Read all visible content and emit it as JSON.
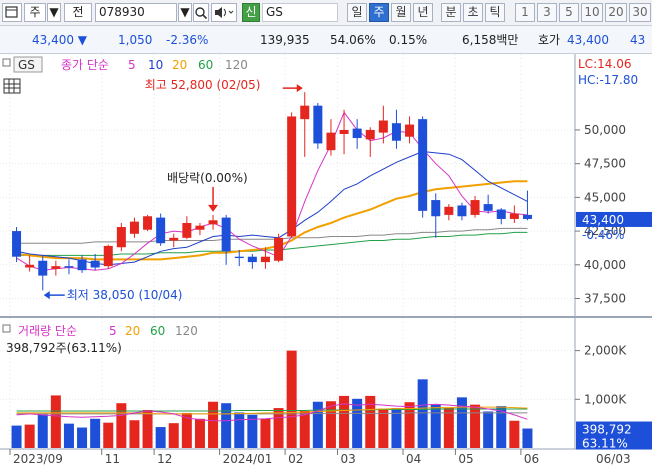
{
  "toolbar": {
    "type_label": "주",
    "prev_label": "전",
    "code": "078930",
    "badge": "신",
    "name": "GS",
    "periods": [
      "일",
      "주",
      "월",
      "년",
      "분",
      "초",
      "틱"
    ],
    "selected_period": "주",
    "numbers": [
      "1",
      "3",
      "5",
      "10",
      "20",
      "30"
    ]
  },
  "info": {
    "price": "43,400 ▼",
    "change": "1,050",
    "change_pct": "-2.36%",
    "volume": "139,935",
    "vol_ratio": "54.06%",
    "turnover": "0.15%",
    "amount": "6,158백만",
    "quote_label": "호가",
    "quote_price": "43,400",
    "quote_count": "43"
  },
  "price_panel": {
    "tag": "GS",
    "legend_prefix": "종가 단순",
    "ma_values": [
      "5",
      "10",
      "20",
      "60",
      "120"
    ],
    "ma_colors": [
      "#d633c8",
      "#1f3fc8",
      "#f2a000",
      "#22a048",
      "#888888"
    ],
    "lc_label": "LC:14.06",
    "hc_label": "HC:-17.80",
    "y_ticks": [
      "50,000",
      "47,500",
      "45,000",
      "42,500",
      "40,000",
      "37,500"
    ],
    "current_price": "43,400",
    "current_pct": "-0.46%",
    "high_label": "최고 52,800 (02/05)",
    "low_label": "최저 38,050 (10/04)",
    "dividend_label": "배당락(0.00%)"
  },
  "volume_panel": {
    "title": "거래량 단순",
    "ma_values": [
      "5",
      "20",
      "60",
      "120"
    ],
    "ma_colors": [
      "#d633c8",
      "#f2a000",
      "#22a048",
      "#888888"
    ],
    "value_label": "398,792주(63.11%)",
    "y_ticks": [
      "2,000K",
      "1,000K"
    ],
    "current_value": "398,792",
    "current_pct": "63.11%"
  },
  "x_axis": [
    "2023/09",
    "11",
    "12",
    "2024/01",
    "02",
    "03",
    "04",
    "05",
    "06",
    "06/03"
  ],
  "colors": {
    "up": "#e5261e",
    "down": "#1d4fd8",
    "ma5": "#d633c8",
    "ma10": "#1f3fc8",
    "ma20": "#f2a000",
    "ma60": "#22a048",
    "ma120": "#888888"
  },
  "chart_data": {
    "type": "candlestick",
    "candles": [
      {
        "o": 42500,
        "h": 42800,
        "l": 40200,
        "c": 40600
      },
      {
        "o": 39800,
        "h": 40700,
        "l": 39500,
        "c": 40000
      },
      {
        "o": 40300,
        "h": 40700,
        "l": 38100,
        "c": 39200
      },
      {
        "o": 39700,
        "h": 40300,
        "l": 39200,
        "c": 39900
      },
      {
        "o": 39900,
        "h": 40400,
        "l": 39300,
        "c": 39800
      },
      {
        "o": 40400,
        "h": 40700,
        "l": 39400,
        "c": 39600
      },
      {
        "o": 40300,
        "h": 40800,
        "l": 39600,
        "c": 39800
      },
      {
        "o": 39900,
        "h": 41500,
        "l": 39700,
        "c": 41400
      },
      {
        "o": 41300,
        "h": 43100,
        "l": 41000,
        "c": 42800
      },
      {
        "o": 42300,
        "h": 43500,
        "l": 42000,
        "c": 43200
      },
      {
        "o": 42600,
        "h": 43700,
        "l": 42500,
        "c": 43600
      },
      {
        "o": 43500,
        "h": 43800,
        "l": 41400,
        "c": 41600
      },
      {
        "o": 41800,
        "h": 42300,
        "l": 41300,
        "c": 42000
      },
      {
        "o": 42000,
        "h": 43600,
        "l": 41900,
        "c": 43100
      },
      {
        "o": 42600,
        "h": 43100,
        "l": 42200,
        "c": 42900
      },
      {
        "o": 43000,
        "h": 43700,
        "l": 42600,
        "c": 43300
      },
      {
        "o": 43500,
        "h": 43700,
        "l": 40000,
        "c": 41000
      },
      {
        "o": 40600,
        "h": 41100,
        "l": 39900,
        "c": 40500
      },
      {
        "o": 40600,
        "h": 40800,
        "l": 39700,
        "c": 40200
      },
      {
        "o": 40200,
        "h": 41300,
        "l": 39700,
        "c": 40600
      },
      {
        "o": 40300,
        "h": 42300,
        "l": 40200,
        "c": 42000
      },
      {
        "o": 42100,
        "h": 51300,
        "l": 42000,
        "c": 51000
      },
      {
        "o": 50800,
        "h": 52800,
        "l": 48000,
        "c": 51800
      },
      {
        "o": 51800,
        "h": 52000,
        "l": 48600,
        "c": 49000
      },
      {
        "o": 48500,
        "h": 50800,
        "l": 48100,
        "c": 49800
      },
      {
        "o": 49700,
        "h": 51500,
        "l": 48200,
        "c": 50000
      },
      {
        "o": 50100,
        "h": 50800,
        "l": 48600,
        "c": 49400
      },
      {
        "o": 49300,
        "h": 50200,
        "l": 48000,
        "c": 50000
      },
      {
        "o": 49800,
        "h": 51800,
        "l": 49000,
        "c": 50700
      },
      {
        "o": 50500,
        "h": 51500,
        "l": 48600,
        "c": 49200
      },
      {
        "o": 49500,
        "h": 51000,
        "l": 49000,
        "c": 50400
      },
      {
        "o": 50800,
        "h": 51000,
        "l": 43500,
        "c": 44000
      },
      {
        "o": 44800,
        "h": 45300,
        "l": 42000,
        "c": 43600
      },
      {
        "o": 43700,
        "h": 44500,
        "l": 43300,
        "c": 44300
      },
      {
        "o": 44400,
        "h": 44600,
        "l": 43300,
        "c": 43600
      },
      {
        "o": 43700,
        "h": 45100,
        "l": 43500,
        "c": 44800
      },
      {
        "o": 44500,
        "h": 45200,
        "l": 43800,
        "c": 44000
      },
      {
        "o": 44100,
        "h": 44200,
        "l": 43000,
        "c": 43400
      },
      {
        "o": 43400,
        "h": 44400,
        "l": 43100,
        "c": 43800
      },
      {
        "o": 43700,
        "h": 45500,
        "l": 43300,
        "c": 43400
      }
    ],
    "volume_k": [
      460,
      480,
      690,
      1080,
      500,
      420,
      600,
      520,
      920,
      570,
      780,
      430,
      510,
      720,
      600,
      950,
      920,
      730,
      680,
      600,
      820,
      2000,
      760,
      950,
      960,
      1070,
      1010,
      1070,
      810,
      820,
      940,
      1410,
      890,
      830,
      1040,
      890,
      750,
      860,
      560,
      400
    ],
    "ma_lines": {
      "ma5": [
        40500,
        39900,
        39600,
        39700,
        39800,
        39700,
        39600,
        39700,
        40100,
        40800,
        41600,
        42300,
        42500,
        42400,
        42800,
        43100,
        42700,
        41900,
        41400,
        41000,
        40600,
        42100,
        44700,
        47000,
        48900,
        51300,
        50000,
        49200,
        49400,
        49900,
        49800,
        48600,
        47500,
        46600,
        45100,
        44000,
        43900,
        44000,
        43800,
        43700
      ],
      "ma10": [
        41000,
        40800,
        40700,
        40600,
        40500,
        40300,
        40100,
        40000,
        40100,
        40200,
        40600,
        41000,
        41200,
        41300,
        41700,
        42100,
        42200,
        42100,
        42200,
        42100,
        42000,
        42600,
        43300,
        43900,
        44700,
        45600,
        46000,
        46600,
        47100,
        47600,
        48000,
        48400,
        48300,
        48200,
        47800,
        47000,
        46200,
        45700,
        45200,
        44700
      ],
      "ma20": [
        40800,
        40700,
        40600,
        40500,
        40500,
        40500,
        40400,
        40400,
        40400,
        40400,
        40400,
        40400,
        40500,
        40600,
        40700,
        40900,
        40900,
        41000,
        41100,
        41200,
        41400,
        41800,
        42400,
        42800,
        43100,
        43500,
        43800,
        44100,
        44500,
        44900,
        45100,
        45400,
        45600,
        45700,
        45800,
        45900,
        46000,
        46100,
        46200,
        46200
      ],
      "ma60": [
        40700,
        40700,
        40700,
        40700,
        40700,
        40700,
        40700,
        40700,
        40800,
        40800,
        40800,
        40900,
        40900,
        40900,
        41000,
        41000,
        41000,
        41000,
        41000,
        41100,
        41100,
        41200,
        41300,
        41400,
        41500,
        41600,
        41700,
        41800,
        41800,
        41900,
        41900,
        42000,
        42100,
        42100,
        42200,
        42200,
        42300,
        42300,
        42400,
        42400
      ],
      "ma120": [
        41600,
        41600,
        41600,
        41600,
        41600,
        41600,
        41700,
        41700,
        41700,
        41700,
        41700,
        41800,
        41800,
        41800,
        41800,
        41800,
        41900,
        41900,
        41900,
        41900,
        41900,
        42000,
        42000,
        42000,
        42100,
        42100,
        42100,
        42200,
        42200,
        42300,
        42300,
        42400,
        42400,
        42500,
        42500,
        42600,
        42600,
        42700,
        42700,
        42700
      ]
    },
    "vol_ma_lines": {
      "ma5": [
        680,
        700,
        680,
        660,
        640,
        630,
        640,
        650,
        670,
        720,
        760,
        740,
        700,
        620,
        580,
        560,
        560,
        580,
        590,
        600,
        620,
        640,
        680,
        760,
        860,
        910,
        880,
        900,
        880,
        860,
        850,
        880,
        900,
        880,
        860,
        840,
        800,
        760,
        680,
        590
      ],
      "ma20": [
        720,
        720,
        720,
        720,
        720,
        720,
        720,
        720,
        720,
        720,
        710,
        700,
        700,
        700,
        700,
        700,
        700,
        710,
        710,
        720,
        720,
        730,
        740,
        750,
        760,
        770,
        780,
        790,
        800,
        810,
        810,
        820,
        830,
        830,
        840,
        840,
        840,
        840,
        830,
        820
      ],
      "ma60": [
        760,
        760,
        760,
        760,
        760,
        760,
        760,
        760,
        760,
        760,
        760,
        760,
        760,
        760,
        760,
        760,
        760,
        770,
        770,
        770,
        770,
        770,
        770,
        780,
        780,
        780,
        780,
        780,
        790,
        790,
        790,
        790,
        800,
        800,
        800,
        800,
        800,
        800,
        800,
        800
      ],
      "ma120": [
        700,
        700,
        700,
        700,
        700,
        700,
        700,
        700,
        700,
        700,
        700,
        700,
        700,
        700,
        700,
        700,
        700,
        700,
        700,
        700,
        700,
        700,
        700,
        710,
        710,
        710,
        710,
        710,
        710,
        710,
        720,
        720,
        720,
        720,
        720,
        720,
        720,
        720,
        720,
        720
      ]
    },
    "price_range": [
      36500,
      54000
    ],
    "volume_range_k": [
      0,
      2300
    ],
    "y_ticks": [
      37500,
      40000,
      42500,
      45000,
      47500,
      50000
    ],
    "vol_ticks_k": [
      1000,
      2000
    ]
  }
}
